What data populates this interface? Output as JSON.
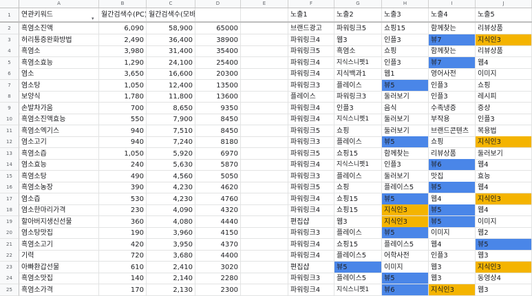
{
  "columns": [
    "A",
    "B",
    "C",
    "D",
    "E",
    "F",
    "G",
    "H",
    "I",
    "J"
  ],
  "header_row": {
    "number": "1",
    "cells": [
      "연관키워드",
      "월간검색수(PC)",
      "월간검색수(모바일)",
      "",
      "",
      "노출1",
      "노출2",
      "노출3",
      "노출4",
      "노출5"
    ]
  },
  "rows": [
    {
      "n": "2",
      "cells": [
        "흑염소진액",
        "6,090",
        "58,900",
        "65000",
        "",
        "브랜드광고",
        "파워링크5",
        "쇼핑15",
        "함께찾는",
        "리뷰상품"
      ],
      "hl": {}
    },
    {
      "n": "3",
      "cells": [
        "허리통증완화방법",
        "2,490",
        "36,400",
        "38900",
        "",
        "파워링크4",
        "웹3",
        "인플3",
        "뷰7",
        "지식인3"
      ],
      "hl": {
        "8": "blue",
        "9": "orange"
      }
    },
    {
      "n": "4",
      "cells": [
        "흑염소",
        "3,980",
        "31,400",
        "35400",
        "",
        "파워링크5",
        "흑염소",
        "쇼핑",
        "함께찾는",
        "리뷰상품"
      ],
      "hl": {}
    },
    {
      "n": "5",
      "cells": [
        "흑염소효능",
        "1,290",
        "24,100",
        "25400",
        "",
        "파워링크4",
        "지식스니펫1",
        "인플3",
        "뷰7",
        "웹4"
      ],
      "hl": {
        "8": "blue"
      }
    },
    {
      "n": "6",
      "cells": [
        "염소",
        "3,650",
        "16,600",
        "20300",
        "",
        "파워링크4",
        "지식백과1",
        "웹1",
        "영어사전",
        "이미지"
      ],
      "hl": {}
    },
    {
      "n": "7",
      "cells": [
        "염소탕",
        "1,050",
        "12,400",
        "13500",
        "",
        "파워링크3",
        "플레이스",
        "뷰5",
        "인플3",
        "쇼핑"
      ],
      "hl": {
        "7": "blue"
      }
    },
    {
      "n": "8",
      "cells": [
        "보양식",
        "1,780",
        "11,800",
        "13600",
        "",
        "플레이스",
        "파워링크3",
        "둘러보기",
        "인플3",
        "레시피"
      ],
      "hl": {}
    },
    {
      "n": "9",
      "cells": [
        "손발차가움",
        "700",
        "8,650",
        "9350",
        "",
        "파워링크4",
        "인플3",
        "음식",
        "수족냉증",
        "증상"
      ],
      "hl": {}
    },
    {
      "n": "10",
      "cells": [
        "흑염소진액효능",
        "550",
        "7,900",
        "8450",
        "",
        "파워링크4",
        "지식스니펫1",
        "둘러보기",
        "부작용",
        "인플3"
      ],
      "hl": {}
    },
    {
      "n": "11",
      "cells": [
        "흑염소엑기스",
        "940",
        "7,510",
        "8450",
        "",
        "파워링크5",
        "쇼핑",
        "둘러보기",
        "브랜드콘텐츠",
        "복용법"
      ],
      "hl": {}
    },
    {
      "n": "12",
      "cells": [
        "염소고기",
        "940",
        "7,240",
        "8180",
        "",
        "파워링크3",
        "플레이스",
        "뷰5",
        "쇼핑",
        "지식인3"
      ],
      "hl": {
        "7": "blue",
        "9": "orange"
      }
    },
    {
      "n": "13",
      "cells": [
        "흑염소즙",
        "1,050",
        "5,920",
        "6970",
        "",
        "파워링크5",
        "쇼핑15",
        "함께찾는",
        "리뷰상품",
        "둘러보기"
      ],
      "hl": {}
    },
    {
      "n": "14",
      "cells": [
        "염소효능",
        "240",
        "5,630",
        "5870",
        "",
        "파워링크4",
        "지식스니펫1",
        "인플3",
        "뷰6",
        "웹4"
      ],
      "hl": {
        "8": "blue"
      }
    },
    {
      "n": "15",
      "cells": [
        "흑염소탕",
        "490",
        "4,560",
        "5050",
        "",
        "파워링크3",
        "플레이스",
        "둘러보기",
        "맛집",
        "효능"
      ],
      "hl": {}
    },
    {
      "n": "16",
      "cells": [
        "흑염소농장",
        "390",
        "4,230",
        "4620",
        "",
        "파워링크5",
        "쇼핑",
        "플레이스5",
        "뷰5",
        "웹4"
      ],
      "hl": {
        "8": "blue"
      }
    },
    {
      "n": "17",
      "cells": [
        "염소즙",
        "530",
        "4,230",
        "4760",
        "",
        "파워링크4",
        "쇼핑15",
        "뷰5",
        "웹4",
        "지식인3"
      ],
      "hl": {
        "7": "blue",
        "9": "orange"
      }
    },
    {
      "n": "18",
      "cells": [
        "염소한마리가격",
        "230",
        "4,090",
        "4320",
        "",
        "파워링크4",
        "쇼핑15",
        "지식인3",
        "뷰5",
        "웹4"
      ],
      "hl": {
        "7": "orange",
        "8": "blue"
      }
    },
    {
      "n": "19",
      "cells": [
        "할아버지생신선물",
        "360",
        "4,080",
        "4440",
        "",
        "편집샵",
        "웹3",
        "지식인3",
        "뷰5",
        "이미지"
      ],
      "hl": {
        "7": "orange",
        "8": "blue"
      }
    },
    {
      "n": "20",
      "cells": [
        "염소탕맛집",
        "190",
        "3,960",
        "4150",
        "",
        "파워링크3",
        "플레이스",
        "뷰5",
        "이미지",
        "웹2"
      ],
      "hl": {
        "7": "blue"
      }
    },
    {
      "n": "21",
      "cells": [
        "흑염소고기",
        "420",
        "3,950",
        "4370",
        "",
        "파워링크4",
        "쇼핑15",
        "플레이스5",
        "웹4",
        "뷰5"
      ],
      "hl": {
        "9": "blue"
      }
    },
    {
      "n": "22",
      "cells": [
        "기력",
        "720",
        "3,680",
        "4400",
        "",
        "파워링크4",
        "플레이스5",
        "어학사전",
        "인플3",
        "웹3"
      ],
      "hl": {}
    },
    {
      "n": "23",
      "cells": [
        "아빠환갑선물",
        "610",
        "2,410",
        "3020",
        "",
        "편집샵",
        "뷰5",
        "이미지",
        "웹3",
        "지식인3"
      ],
      "hl": {
        "6": "blue",
        "9": "orange"
      }
    },
    {
      "n": "24",
      "cells": [
        "흑염소맛집",
        "140",
        "2,140",
        "2280",
        "",
        "파워링크3",
        "플레이스5",
        "뷰5",
        "웹3",
        "동영상4"
      ],
      "hl": {
        "7": "blue"
      }
    },
    {
      "n": "25",
      "cells": [
        "흑염소가격",
        "170",
        "2,130",
        "2300",
        "",
        "파워링크4",
        "지식스니펫1",
        "뷰6",
        "지식인3",
        "웹3"
      ],
      "hl": {
        "7": "blue",
        "8": "orange"
      }
    }
  ],
  "colors": {
    "blue": "#4a86e8",
    "orange": "#f4b400"
  }
}
